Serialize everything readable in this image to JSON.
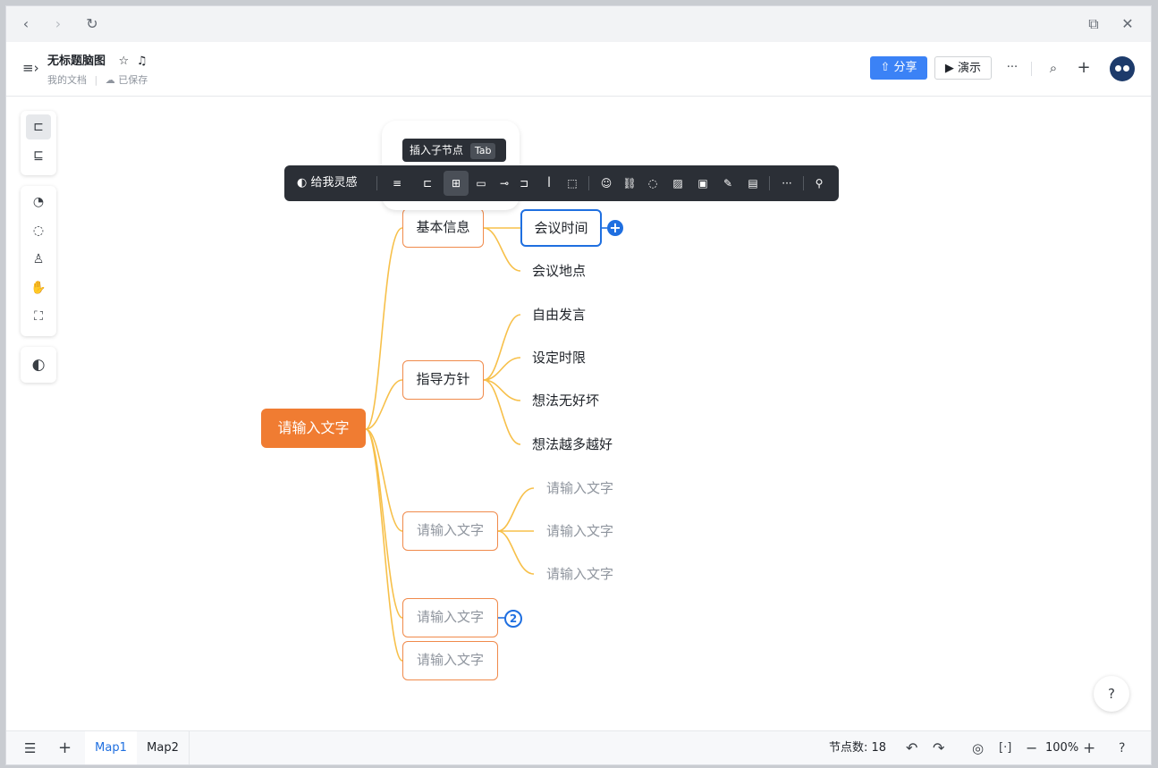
{
  "browser": {
    "back_icon": "chevron-left-icon",
    "forward_icon": "chevron-right-icon",
    "reload_icon": "reload-icon",
    "popout_icon": "popout-icon",
    "close_icon": "close-icon"
  },
  "header": {
    "title": "无标题脑图",
    "location": "我的文档",
    "saved": "已保存",
    "share": "分享",
    "present": "▶ 演示",
    "more": "···"
  },
  "toolbar": {
    "inspire": "给我灵感",
    "tooltip_label": "插入子节点",
    "tooltip_key": "Tab"
  },
  "mindmap": {
    "root": "请输入文字",
    "branches": [
      {
        "label": "基本信息",
        "children": [
          "会议时间",
          "会议地点"
        ]
      },
      {
        "label": "指导方针",
        "children": [
          "自由发言",
          "设定时限",
          "想法无好坏",
          "想法越多越好"
        ]
      },
      {
        "label": "请输入文字",
        "children": [
          "请输入文字",
          "请输入文字",
          "请输入文字"
        ]
      },
      {
        "label": "请输入文字",
        "collapsed_count": "2"
      },
      {
        "label": "请输入文字"
      }
    ]
  },
  "status": {
    "tabs": [
      "Map1",
      "Map2"
    ],
    "node_count": "节点数: 18",
    "zoom": "100%"
  },
  "colors": {
    "root": "#f07c32",
    "branch_border": "#f08a4b",
    "line": "#f7c04a",
    "accent": "#1f6fe0",
    "share_bg": "#3b82f6"
  }
}
